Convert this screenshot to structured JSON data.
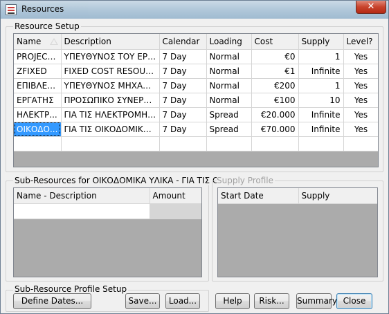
{
  "window": {
    "title": "Resources",
    "close_label": "✕"
  },
  "resource_setup": {
    "label": "Resource Setup",
    "columns": [
      "Name",
      "Description",
      "Calendar",
      "Loading",
      "Cost",
      "Supply",
      "Level?"
    ],
    "rows": [
      [
        "PROJECT ...",
        "ΥΠΕΥΘΥΝΟΣ ΤΟΥ ΕΡΓΟΥ",
        "7 Day",
        "Normal",
        "€0",
        "1",
        "Yes"
      ],
      [
        "ZFIXED",
        "FIXED COST RESOURCE ...",
        "7 Day",
        "Normal",
        "€1",
        "Infinite",
        "Yes"
      ],
      [
        "ΕΠΙΒΛΕΠ...",
        "ΥΠΕΥΘΥΝΟΣ ΜΗΧΑΝΙΚ...",
        "7 Day",
        "Normal",
        "€200",
        "1",
        "Yes"
      ],
      [
        "ΕΡΓΑΤΗΣ",
        "ΠΡΟΣΩΠΙΚΟ ΣΥΝΕΡΓΕΙ...",
        "7 Day",
        "Normal",
        "€100",
        "10",
        "Yes"
      ],
      [
        "ΗΛΕΚΤΡ...",
        "ΓΙΑ ΤΙΣ ΗΛΕΚΤΡΟΜΗΧ...",
        "7 Day",
        "Spread",
        "€20.000",
        "Infinite",
        "Yes"
      ],
      [
        "ΟΙΚΟΔΟ...",
        "ΓΙΑ ΤΙΣ ΟΙΚΟΔΟΜΙΚΕΣ Ε...",
        "7 Day",
        "Spread",
        "€70.000",
        "Infinite",
        "Yes"
      ]
    ]
  },
  "sub_resources": {
    "label": "Sub-Resources for ΟΙΚΟΔΟΜΙΚΑ ΥΛΙΚΑ - ΓΙΑ ΤΙΣ ΟΙΚΟΔΟΜΙΚΕΣ",
    "columns": [
      "Name - Description",
      "Amount"
    ]
  },
  "supply_profile": {
    "label": "Supply Profile",
    "columns": [
      "Start Date",
      "Supply"
    ]
  },
  "profile_setup": {
    "label": "Sub-Resource Profile Setup",
    "define_dates": "Define Dates...",
    "save": "Save...",
    "load": "Load..."
  },
  "buttons": {
    "help": "Help",
    "risk": "Risk...",
    "summary": "Summary",
    "close": "Close"
  }
}
